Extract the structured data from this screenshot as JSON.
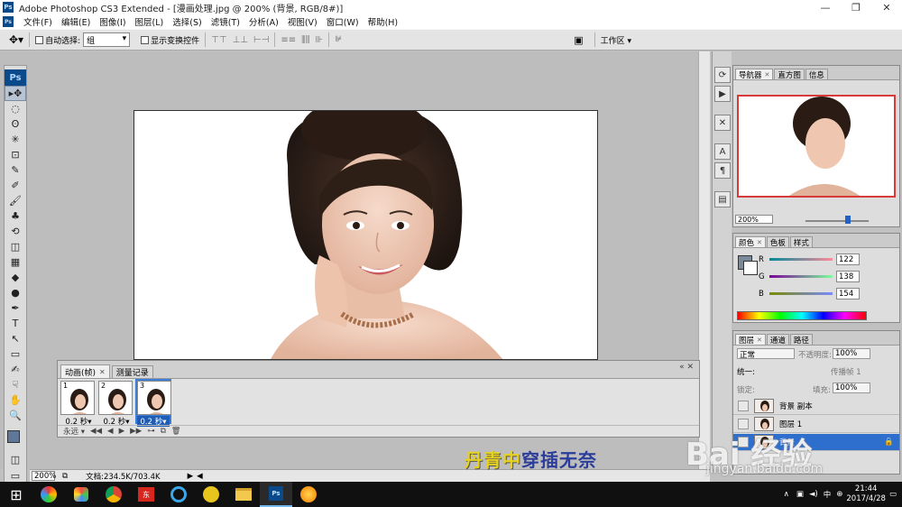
{
  "window": {
    "title": "Adobe Photoshop CS3 Extended - [漫画处理.jpg @ 200% (背景, RGB/8#)]",
    "ps_logo": "Ps",
    "min": "—",
    "max": "❐",
    "close": "✕"
  },
  "menu": [
    "文件(F)",
    "编辑(E)",
    "图像(I)",
    "图层(L)",
    "选择(S)",
    "滤镜(T)",
    "分析(A)",
    "视图(V)",
    "窗口(W)",
    "帮助(H)"
  ],
  "options": {
    "auto_select_label": "自动选择:",
    "auto_select_value": "组",
    "show_transform_label": "显示变换控件",
    "workspace_label": "工作区 ▾"
  },
  "toolbox": {
    "logo": "Ps",
    "tools": [
      "▸✥",
      "◌",
      "ʘ",
      "✳",
      "⊡",
      "✎",
      "✐",
      "🖌",
      "♣",
      "⟲",
      "◫",
      "▦",
      "◆",
      "●",
      "✒",
      "T",
      "↖",
      "▭",
      "✍",
      "☟",
      "✋",
      "🔍"
    ]
  },
  "status": {
    "zoom": "200%",
    "doc": "文档:234.5K/703.4K"
  },
  "animation": {
    "tab_animation": "动画(帧)",
    "tab_history": "测量记录",
    "frames": [
      {
        "num": "1",
        "delay": "0.2 秒▾"
      },
      {
        "num": "2",
        "delay": "0.2 秒▾"
      },
      {
        "num": "3",
        "delay": "0.2 秒▾"
      }
    ],
    "loop": "永远 ▾",
    "controls": [
      "◀◀",
      "◀",
      "▶",
      "▶▶",
      "⊶",
      "⧉",
      "🗑"
    ]
  },
  "navigator": {
    "tabs": [
      "导航器",
      "直方图",
      "信息"
    ],
    "zoom": "200%"
  },
  "color": {
    "tabs": [
      "颜色",
      "色板",
      "样式"
    ],
    "r_label": "R",
    "r": "122",
    "g_label": "G",
    "g": "138",
    "b_label": "B",
    "b": "154",
    "fg_color": "#7a8a9a"
  },
  "layers": {
    "tabs": [
      "图层",
      "通道",
      "路径"
    ],
    "blend": "正常",
    "opacity_label": "不透明度:",
    "opacity": "100%",
    "lock_label": "锁定:",
    "unify_label": "统一:",
    "propagate_label": "传播帧 1",
    "fill_label": "填充:",
    "fill": "100%",
    "rows": [
      {
        "name": "背景 副本"
      },
      {
        "name": "图层 1"
      },
      {
        "name": "背景"
      }
    ]
  },
  "overlay": {
    "text1": "丹青中",
    "text2": "穿插无奈"
  },
  "watermark": {
    "logo": "Bai 经验",
    "url": "jingyan.baidu.com"
  },
  "taskbar": {
    "time": "21:44",
    "date": "2017/4/28",
    "ime": "中",
    "start": "⊞"
  }
}
